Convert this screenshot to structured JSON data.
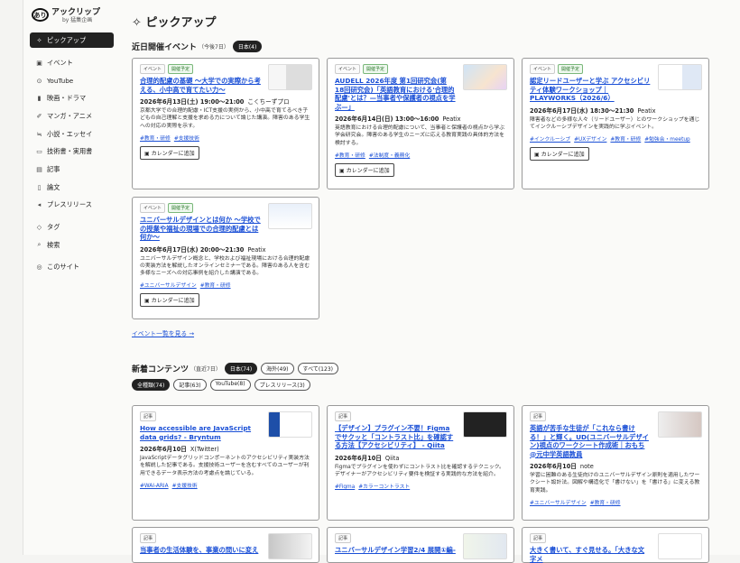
{
  "brand": {
    "mark": "あり",
    "name": "アックリップ",
    "sub": "by 猛集企画"
  },
  "sidebar": {
    "items": [
      {
        "icon": "✧",
        "label": "ピックアップ",
        "active": true
      },
      {
        "icon": "▣",
        "label": "イベント"
      },
      {
        "icon": "⊙",
        "label": "YouTube"
      },
      {
        "icon": "▮",
        "label": "映画・ドラマ"
      },
      {
        "icon": "✐",
        "label": "マンガ・アニメ"
      },
      {
        "icon": "≒",
        "label": "小説・エッセイ"
      },
      {
        "icon": "▭",
        "label": "技術書・実用書"
      },
      {
        "icon": "▤",
        "label": "記事"
      },
      {
        "icon": "▯",
        "label": "論文"
      },
      {
        "icon": "◂",
        "label": "プレスリリース"
      },
      {
        "icon": "◇",
        "label": "タグ",
        "gap": true
      },
      {
        "icon": "⌕",
        "label": "検索"
      },
      {
        "icon": "◎",
        "label": "このサイト",
        "gap": true
      }
    ]
  },
  "page": {
    "title": "ピックアップ",
    "title_icon": "✧"
  },
  "events": {
    "title": "近日開催イベント",
    "sub": "（今後7日）",
    "filter": "日本(4)",
    "more": "イベント一覧を見る →",
    "cards": [
      {
        "tags": [
          "イベント",
          "開催予定"
        ],
        "title": "合理的配慮の基礎 〜大学での実際から考える、小中高で育てたい力〜",
        "date": "2026年6月13日(土) 19:00〜21:00",
        "source": "こくちーずプロ",
        "desc": "京都大学での合理的配慮・ICT支援の実例から、小中高で育てるべき子どもの自己理解と支援を求める力について論じた講演。障害のある学生への対応の実際を示す。",
        "hashtags": [
          "#教育・研修",
          "#支援技術"
        ],
        "btn": "カレンダーに追加"
      },
      {
        "tags": [
          "イベント",
          "開催予定"
        ],
        "title": "AUDELL 2026年度 第1回研究会(第18回研究会)「英語教育における'合理的配慮'とは？—当事者や保護者の視点を学ぶ—」",
        "date": "2026年6月14日(日) 13:00〜16:00",
        "source": "Peatix",
        "desc": "英語教育における合理的配慮について、当事者と保護者の視点から学ぶ学会研究会。障害のある学生のニーズに応える教育実践の具体的方法を検討する。",
        "hashtags": [
          "#教育・研修",
          "#法制度・義務化"
        ],
        "btn": "カレンダーに追加"
      },
      {
        "tags": [
          "イベント",
          "開催予定"
        ],
        "title": "認定リードユーザーと学ぶ アクセシビリティ体験ワークショップ｜PLAYWORKS（2026/6）",
        "date": "2026年6月17日(水) 18:30〜21:30",
        "source": "Peatix",
        "desc": "障害者などの多様な人々（リードユーザー）とのワークショップを通じてインクルーシブデザインを実践的に学ぶイベント。",
        "hashtags": [
          "#インクルーシブ",
          "#UXデザイン",
          "#教育・研修",
          "#勉強会・meetup"
        ],
        "btn": "カレンダーに追加"
      },
      {
        "tags": [
          "イベント",
          "開催予定"
        ],
        "title": "ユニバーサルデザインとは何か 〜学校での授業や福祉の現場での合理的配慮とは何か〜",
        "date": "2026年6月17日(水) 20:00〜21:30",
        "source": "Peatix",
        "desc": "ユニバーサルデザイン概念と、学校および福祉現場における合理的配慮の実装方法を解説したオンラインセミナーである。障害のある人を含む多様なニーズへの対応事例を紹介した講演である。",
        "hashtags": [
          "#ユニバーサルデザイン",
          "#教育・研修"
        ],
        "btn": "カレンダーに追加"
      }
    ]
  },
  "content": {
    "title": "新着コンテンツ",
    "sub": "（直近7日）",
    "filters": [
      {
        "label": "日本(74)",
        "on": true
      },
      {
        "label": "海外(49)"
      },
      {
        "label": "すべて(123)"
      }
    ],
    "types": [
      {
        "label": "全種類(74)",
        "on": true
      },
      {
        "label": "記事(63)"
      },
      {
        "label": "YouTube(8)"
      },
      {
        "label": "プレスリリース(3)"
      }
    ],
    "cards": [
      {
        "tags": [
          "記事"
        ],
        "title": "How accessible are JavaScript data grids? - Bryntum",
        "date": "2026年6月10日",
        "source": "X(Twitter)",
        "desc": "JavaScriptデータグリッドコンポーネントのアクセシビリティ実装方法を解説した記事である。支援技術ユーザーを含むすべてのユーザーが利用できるデータ表示方法の考慮点を論じている。",
        "hashtags": [
          "#WAI-ARIA",
          "#支援技術"
        ]
      },
      {
        "tags": [
          "記事"
        ],
        "title": "【デザイン】プラグイン不要！Figmaでサクッと「コントラスト比」を確認する方法【アクセシビリティ】 - Qiita",
        "date": "2026年6月10日",
        "source": "Qiita",
        "desc": "Figmaでプラグインを使わずにコントラスト比を確認するテクニック。デザイナーがアクセシビリティ要件を検証する実践的な方法を紹介。",
        "hashtags": [
          "#Figma",
          "#カラーコントラスト"
        ]
      },
      {
        "tags": [
          "記事"
        ],
        "title": "英語が苦手な生徒が「これなら書ける！」と輝く。UD(ユニバーサルデザイン)視点のワークシート作成術｜おもち@元中学英語教員",
        "date": "2026年6月10日",
        "source": "note",
        "desc": "学習に困難のある生徒向けのユニバーサルデザイン原則を適用したワークシート設計法。図解や構造化で「書けない」を「書ける」に変える教育実践。",
        "hashtags": [
          "#ユニバーサルデザイン",
          "#教育・研修"
        ]
      },
      {
        "tags": [
          "記事"
        ],
        "title": "当事者の生活体験を、事業の問いに変え",
        "date": "",
        "source": "",
        "desc": "",
        "hashtags": []
      },
      {
        "tags": [
          "記事"
        ],
        "title": "ユニバーサルデザイン学習2/4 展開①編-",
        "date": "",
        "source": "",
        "desc": "",
        "hashtags": []
      },
      {
        "tags": [
          "記事"
        ],
        "title": "大きく書いて、すぐ見せる。「大きな文字メ",
        "date": "",
        "source": "",
        "desc": "",
        "hashtags": []
      }
    ]
  },
  "colors": {
    "link": "#1a4fd6",
    "active": "#222222",
    "tag_green": "#2d7a2d"
  }
}
